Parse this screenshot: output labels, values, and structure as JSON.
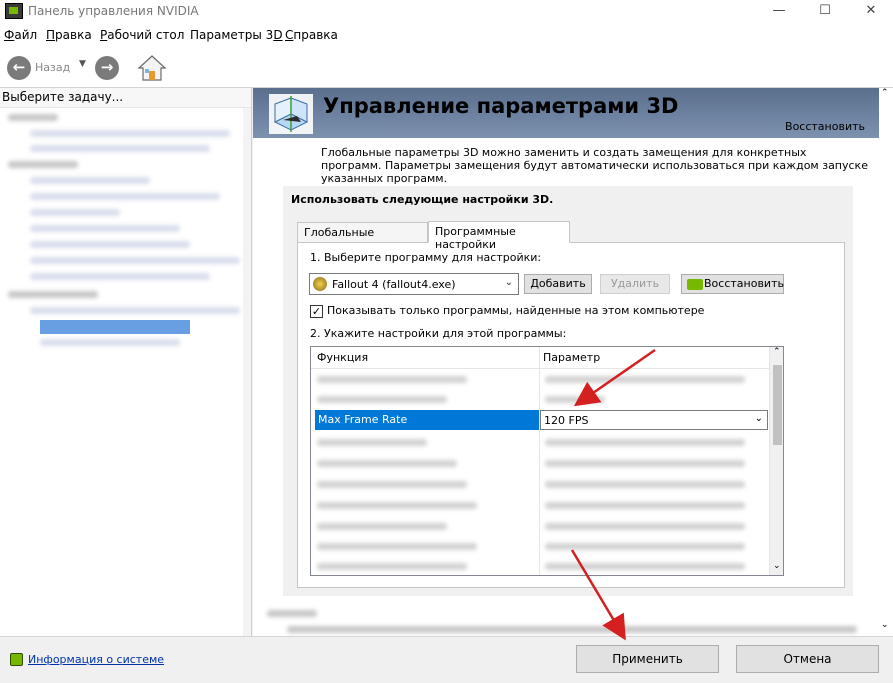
{
  "window": {
    "title": "Панель управления NVIDIA",
    "minimize": "—",
    "maximize": "☐",
    "close": "✕"
  },
  "menu": [
    {
      "label": "Файл",
      "mnemonic": "Ф",
      "rest": "айл"
    },
    {
      "label": "Правка",
      "mnemonic": "П",
      "rest": "равка"
    },
    {
      "label": "Рабочий стол",
      "mnemonic": "Р",
      "rest": "абочий стол"
    },
    {
      "label": "Параметры 3D",
      "mnemonic": "D",
      "pre": "Параметры 3"
    },
    {
      "label": "Справка",
      "mnemonic": "С",
      "rest": "правка"
    }
  ],
  "toolbar": {
    "back_label": "Назад",
    "back_icon": "arrow-left-icon",
    "forward_icon": "arrow-right-icon",
    "home_icon": "home-icon"
  },
  "left_pane": {
    "header": "Выберите задачу..."
  },
  "page": {
    "title": "Управление параметрами 3D",
    "restore_link": "Восстановить",
    "description": "Глобальные параметры 3D можно заменить и создать замещения для конкретных программ. Параметры замещения будут автоматически использоваться при каждом запуске указанных программ.",
    "use_settings_label": "Использовать следующие настройки 3D.",
    "tabs": [
      {
        "label": "Глобальные параметры",
        "active": false
      },
      {
        "label": "Программные настройки",
        "active": true
      }
    ],
    "step1_label": "1. Выберите программу для настройки:",
    "program_selected": "Fallout 4 (fallout4.exe)",
    "add_button": "Добавить",
    "remove_button": "Удалить",
    "restore_button": "Восстановить",
    "show_only_checkbox": "Показывать только программы, найденные на этом компьютере",
    "show_only_checked": true,
    "step2_label": "2. Укажите настройки для этой программы:",
    "grid": {
      "col_function": "Функция",
      "col_parameter": "Параметр",
      "selected_function": "Max Frame Rate",
      "selected_value": "120 FPS"
    }
  },
  "bottom": {
    "sysinfo_link": "Информация о системе",
    "apply_button": "Применить",
    "cancel_button": "Отмена"
  },
  "colors": {
    "accent_selected": "#0078d7",
    "nvidia_green": "#76b900",
    "banner": "#6f84a2",
    "annotation_arrow": "#d42020"
  }
}
